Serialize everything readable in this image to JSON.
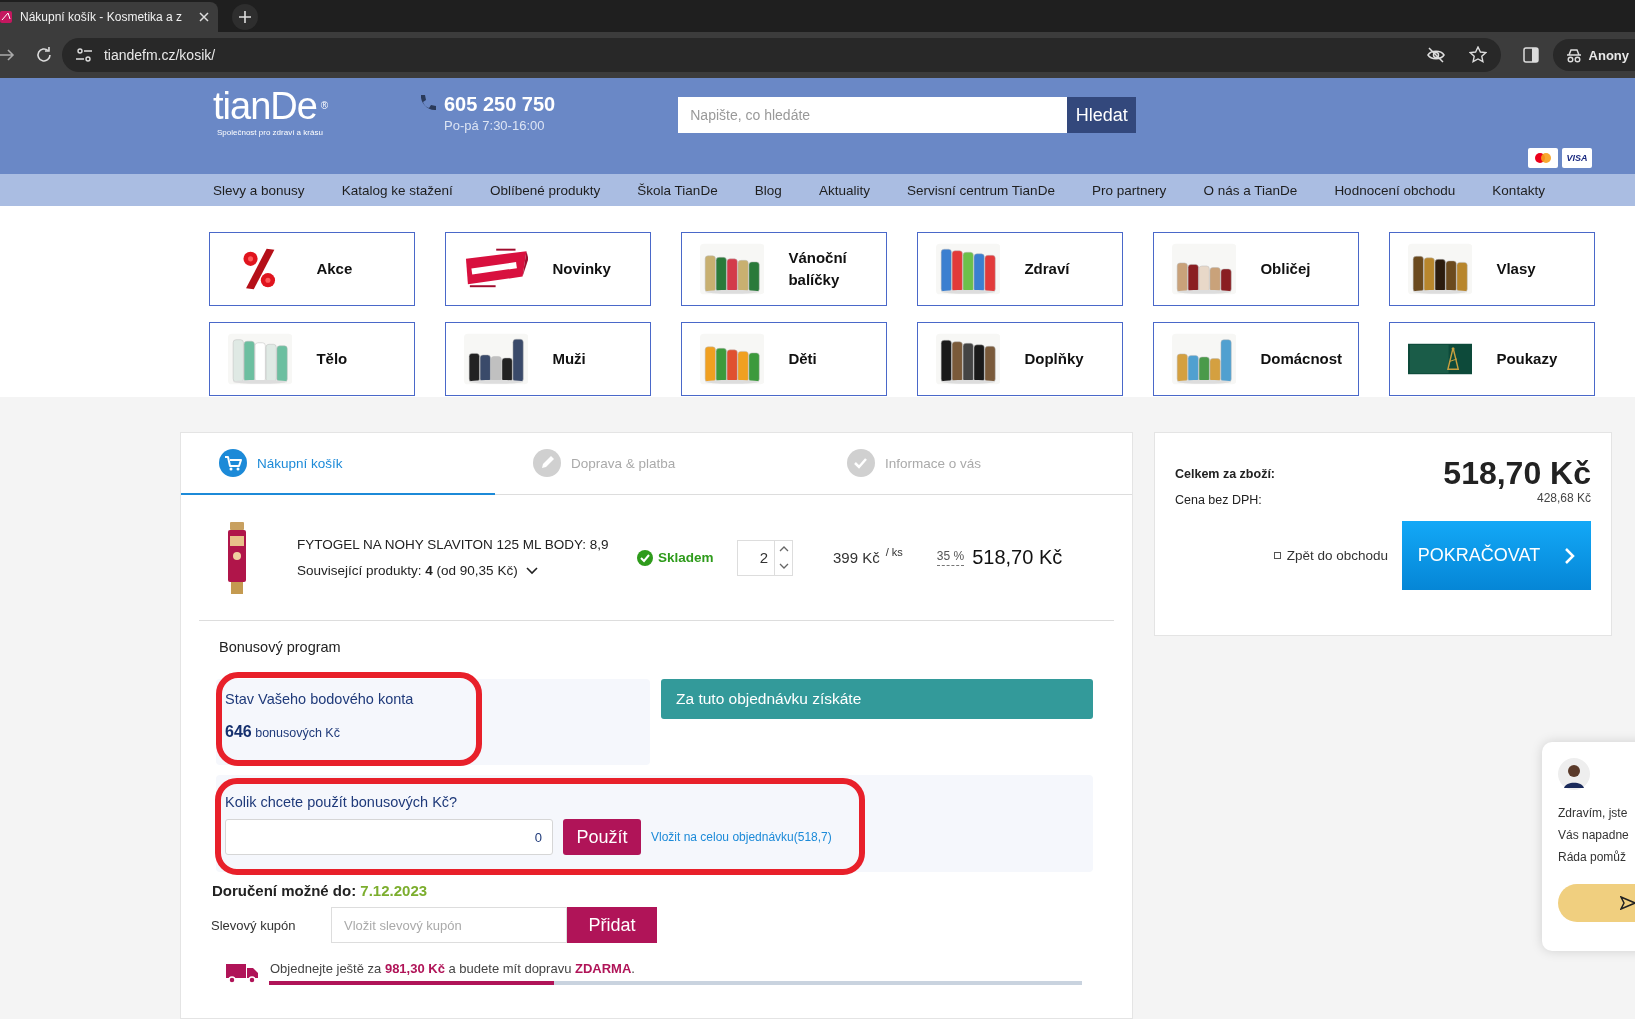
{
  "browser": {
    "tab_title": "Nákupní košík - Kosmetika a z",
    "url": "tiandefm.cz/kosik/",
    "profile": "Anony"
  },
  "header": {
    "logo": "tianDe$^{®}$",
    "tagline": "Společnost pro zdraví a krásu",
    "phone": "605 250 750",
    "hours": "Po-pá 7:30-16:00",
    "search": {
      "placeholder": "Napište, co hledáte",
      "button": "Hledat"
    },
    "payment_badge": "VISA"
  },
  "nav": [
    "Slevy a bonusy",
    "Katalog ke stažení",
    "Oblíbené produkty",
    "Škola TianDe",
    "Blog",
    "Aktuality",
    "Servisní centrum TianDe",
    "Pro partnery",
    "O nás a TianDe",
    "Hodnocení obchodu",
    "Kontakty"
  ],
  "categories": [
    {
      "label": "Akce"
    },
    {
      "label": "Novinky"
    },
    {
      "label": "Vánoční balíčky"
    },
    {
      "label": "Zdraví"
    },
    {
      "label": "Obličej"
    },
    {
      "label": "Vlasy"
    },
    {
      "label": "Tělo"
    },
    {
      "label": "Muži"
    },
    {
      "label": "Děti"
    },
    {
      "label": "Doplňky"
    },
    {
      "label": "Domácnost"
    },
    {
      "label": "Poukazy"
    }
  ],
  "checkout_steps": [
    {
      "label": "Nákupní košík",
      "selected": true,
      "kind": "cart"
    },
    {
      "label": "Doprava & platba",
      "selected": false,
      "kind": "pencil"
    },
    {
      "label": "Informace o vás",
      "selected": false,
      "kind": "check"
    }
  ],
  "cart_item": {
    "name": "FYTOGEL NA NOHY SLAVITON 125 ML BODY: 8,9",
    "related": "Související produkty: **4** (od 90,35 Kč)",
    "stock": "Skladem",
    "quantity": "2",
    "unit_price": "399 Kč",
    "unit": "/ ks",
    "discount": "35 %",
    "total": "518,70 Kč"
  },
  "bonus": {
    "title": "Bonusový program",
    "account_label": "Stav Vašeho bodového konta",
    "points": "646",
    "points_unit": "bonusových Kč",
    "earn_banner": "Za tuto objednávku získáte",
    "use_question": "Kolik chcete použít bonusových Kč?",
    "use_value": "0",
    "use_button": "Použít",
    "use_all_link": "Vložit na celou objednávku(518,7)"
  },
  "delivery": {
    "label": "Doručení možné do:",
    "date": "7.12.2023"
  },
  "coupon": {
    "label": "Slevový kupón",
    "placeholder": "Vložit slevový kupón",
    "button": "Přidat"
  },
  "free_shipping": {
    "text": "Objednejte ještě za **981,30 Kč** a budete mít dopravu **ZDARMA**.",
    "level": 0.35
  },
  "summary": {
    "total_label": "Celkem za zboží:",
    "total": "518,70 Kč",
    "net_label": "Cena bez DPH:",
    "net": "428,68 Kč",
    "back_link": "Zpět do obchodu",
    "continue_button": "POKRAČOVAT"
  },
  "chat": {
    "lines": [
      "Zdravím, jste",
      "Vás napadne",
      "Ráda pomůž"
    ]
  }
}
